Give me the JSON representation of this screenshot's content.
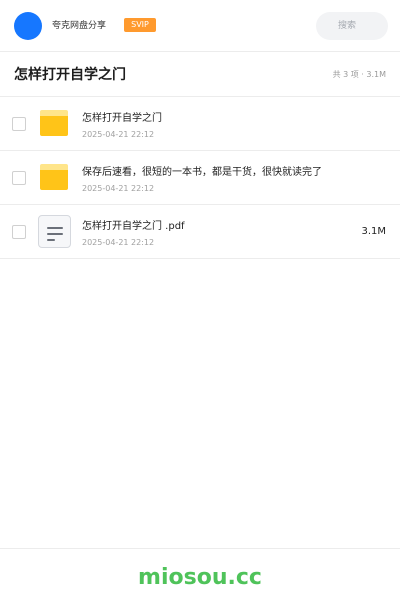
{
  "header": {
    "user_name": "夸克网盘分享",
    "badge": "SVIP",
    "search_placeholder": "搜索"
  },
  "folder": {
    "title": "怎样打开自学之门",
    "summary": "共 3 项 · 3.1M"
  },
  "files": [
    {
      "icon": "folder-icon",
      "name": "怎样打开自学之门",
      "date": "2025-04-21 22:12",
      "size": ""
    },
    {
      "icon": "folder-icon",
      "name": "保存后速看，很短的一本书，都是干货，很快就读完了",
      "date": "2025-04-21 22:12",
      "size": ""
    },
    {
      "icon": "document-icon",
      "name": "怎样打开自学之门 .pdf",
      "date": "2025-04-21 22:12",
      "size": "3.1M"
    }
  ],
  "footer": {
    "brand": "miosou.cc"
  },
  "colors": {
    "accent": "#1677ff",
    "badge": "#ff9a2e",
    "folder": "#ffc418",
    "brand": "#4fc35a"
  }
}
